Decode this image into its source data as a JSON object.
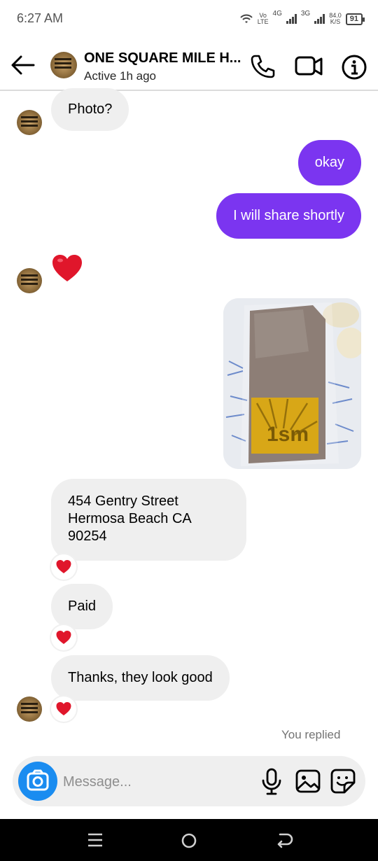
{
  "status_bar": {
    "time": "6:27 AM",
    "volte_top": "Vo",
    "volte_bottom": "LTE",
    "network_1": "4G",
    "network_2": "3G",
    "speed_value": "84.0",
    "speed_unit": "K/S",
    "battery": "91"
  },
  "header": {
    "contact_name": "ONE SQUARE MILE H...",
    "status": "Active 1h ago"
  },
  "messages": [
    {
      "side": "in",
      "text": "Photo?"
    },
    {
      "side": "out",
      "text": "okay"
    },
    {
      "side": "out",
      "text": "I will share shortly"
    },
    {
      "side": "in",
      "emoji": "❤️"
    },
    {
      "side": "out",
      "type": "photo"
    },
    {
      "side": "in",
      "lines": [
        "454 Gentry Street",
        "Hermosa Beach CA",
        "90254"
      ],
      "reaction": "❤️"
    },
    {
      "side": "in",
      "text": "Paid",
      "reaction": "❤️"
    },
    {
      "side": "in",
      "text": "Thanks, they look good",
      "reaction": "❤️"
    }
  ],
  "footer_note": "You replied",
  "composer": {
    "placeholder": "Message..."
  },
  "colors": {
    "outgoing_bubble": "#7b35f0",
    "incoming_bubble": "#efefef",
    "camera_button": "#1a8cf0",
    "reaction_heart": "#e0162b"
  },
  "icons": [
    "back-arrow-icon",
    "phone-icon",
    "video-camera-icon",
    "info-icon",
    "camera-icon",
    "microphone-icon",
    "gallery-icon",
    "sticker-icon",
    "nav-menu-icon",
    "nav-home-icon",
    "nav-back-icon"
  ]
}
